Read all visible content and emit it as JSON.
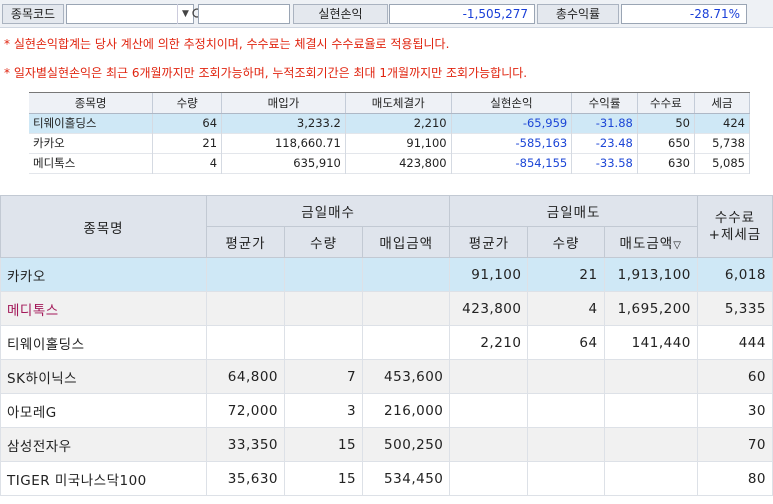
{
  "toolbar": {
    "code_label": "종목코드",
    "code_value": "",
    "realized_label": "실현손익",
    "realized_value": "-1,505,277",
    "total_rate_label": "총수익률",
    "total_rate_value": "-28.71%"
  },
  "notices": [
    "* 실현손익합계는 당사 계산에 의한 추정치이며, 수수료는 체결시 수수료율로 적용됩니다.",
    "* 일자별실현손익은 최근 6개월까지만 조회가능하며, 누적조회기간은 최대 1개월까지만 조회가능합니다."
  ],
  "top_table": {
    "headers": [
      "종목명",
      "수량",
      "매입가",
      "매도체결가",
      "실현손익",
      "수익률",
      "수수료",
      "세금"
    ],
    "rows": [
      [
        "티웨이홀딩스",
        "64",
        "3,233.2",
        "2,210",
        "-65,959",
        "-31.88",
        "50",
        "424"
      ],
      [
        "카카오",
        "21",
        "118,660.71",
        "91,100",
        "-585,163",
        "-23.48",
        "650",
        "5,738"
      ],
      [
        "메디톡스",
        "4",
        "635,910",
        "423,800",
        "-854,155",
        "-33.58",
        "630",
        "5,085"
      ]
    ]
  },
  "bottom_table": {
    "header_name": "종목명",
    "header_buy": "금일매수",
    "header_sell": "금일매도",
    "header_fee": "수수료\n+제세금",
    "sub_headers": [
      "평균가",
      "수량",
      "매입금액",
      "평균가",
      "수량",
      "매도금액"
    ],
    "sort_glyph": "▽",
    "rows": [
      [
        "카카오",
        "",
        "",
        "",
        "91,100",
        "21",
        "1,913,100",
        "6,018"
      ],
      [
        "메디톡스",
        "",
        "",
        "",
        "423,800",
        "4",
        "1,695,200",
        "5,335"
      ],
      [
        "티웨이홀딩스",
        "",
        "",
        "",
        "2,210",
        "64",
        "141,440",
        "444"
      ],
      [
        "SK하이닉스",
        "64,800",
        "7",
        "453,600",
        "",
        "",
        "",
        "60"
      ],
      [
        "아모레G",
        "72,000",
        "3",
        "216,000",
        "",
        "",
        "",
        "30"
      ],
      [
        "삼성전자우",
        "33,350",
        "15",
        "500,250",
        "",
        "",
        "",
        "70"
      ],
      [
        "TIGER 미국나스닥100",
        "35,630",
        "15",
        "534,450",
        "",
        "",
        "",
        "80"
      ]
    ]
  },
  "colors": {
    "negative": "#1c46d6",
    "selected_row": "#cfe8f6",
    "notice": "#e0240f",
    "magenta_name": "#a31859"
  }
}
